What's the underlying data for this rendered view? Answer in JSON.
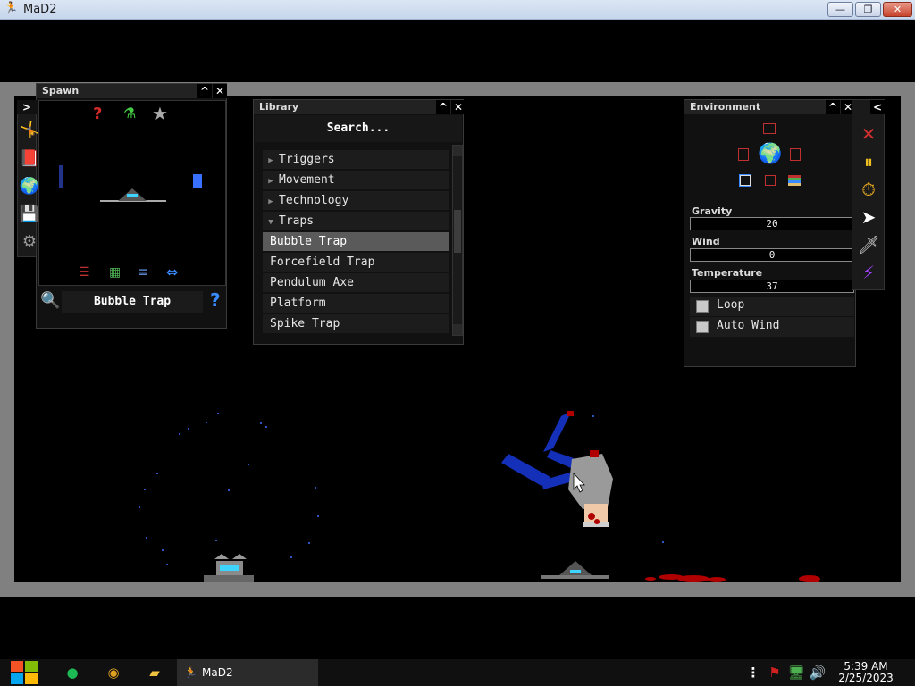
{
  "window": {
    "title": "MaD2",
    "minimize": "—",
    "maximize": "❐",
    "close": "✕"
  },
  "spawn_panel": {
    "title": "Spawn",
    "collapse_label": "^",
    "close_label": "✕",
    "sidebar_toggle": ">",
    "selected_item": "Bubble Trap",
    "help_label": "?",
    "preview_top_icons": [
      "?",
      "⚗",
      "★"
    ],
    "preview_bottom_icons": [
      "sliders-icon",
      "grid-icon",
      "list-icon",
      "swap-icon"
    ]
  },
  "library_panel": {
    "title": "Library",
    "collapse_label": "^",
    "close_label": "✕",
    "search_placeholder": "Search...",
    "categories": [
      {
        "label": "Triggers",
        "expanded": false
      },
      {
        "label": "Movement",
        "expanded": false
      },
      {
        "label": "Technology",
        "expanded": false
      },
      {
        "label": "Traps",
        "expanded": true
      }
    ],
    "items": [
      "Bubble Trap",
      "Forcefield Trap",
      "Pendulum Axe",
      "Platform",
      "Spike Trap"
    ],
    "selected_item": "Bubble Trap"
  },
  "environment_panel": {
    "title": "Environment",
    "collapse_label": "^",
    "close_label": "✕",
    "gravity_label": "Gravity",
    "gravity_value": "20",
    "wind_label": "Wind",
    "wind_value": "0",
    "temperature_label": "Temperature",
    "temperature_value": "37",
    "loop_label": "Loop",
    "loop_checked": false,
    "auto_wind_label": "Auto Wind",
    "auto_wind_checked": false
  },
  "tools": {
    "toggle_label": "<",
    "items": [
      "delete-tool",
      "pause-tool",
      "stopwatch-tool",
      "pointer-tool",
      "knife-tool",
      "lightning-tool"
    ]
  },
  "taskbar": {
    "task_label": "MaD2",
    "time": "5:39 AM",
    "date": "2/25/2023"
  },
  "colors": {
    "frame": "#808080",
    "panel_bg": "#111111",
    "selected": "#5a5a5a",
    "ragdoll_blue": "#1530b8",
    "blood": "#b00000"
  }
}
